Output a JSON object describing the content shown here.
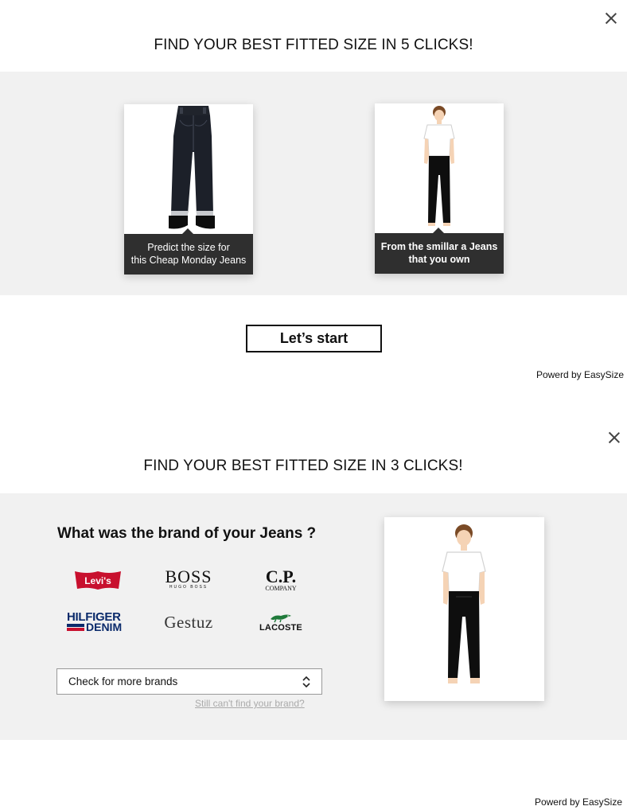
{
  "panel1": {
    "headline": "FIND YOUR BEST FITTED SIZE IN 5 CLICKS!",
    "card_left_caption_line1": "Predict the size for",
    "card_left_caption_line2": "this Cheap Monday Jeans",
    "card_right_caption_line1": "From the smillar a Jeans",
    "card_right_caption_line2": "that you own",
    "start_label": "Let’s start",
    "powered": "Powerd by EasySize"
  },
  "panel2": {
    "headline": "FIND YOUR BEST FITTED SIZE IN 3 CLICKS!",
    "question": "What was the brand of your Jeans ?",
    "brands": {
      "levis": "Levi's",
      "boss": "BOSS",
      "boss_sub": "HUGO BOSS",
      "cp": "C.P.",
      "cp_sub": "COMPANY",
      "hilfiger_top": "HILFIGER",
      "hilfiger_bottom": "DENIM",
      "gestuz": "Gestuz",
      "lacoste": "LACOSTE"
    },
    "select_value": "Check for more brands",
    "cant_find": "Still can't find your brand?",
    "powered": "Powerd by EasySize"
  },
  "icons": {
    "close": "close-icon",
    "select_arrows": "chevron-up-down-icon",
    "jeans": "jeans-product-image",
    "figure": "mannequin-figure"
  }
}
